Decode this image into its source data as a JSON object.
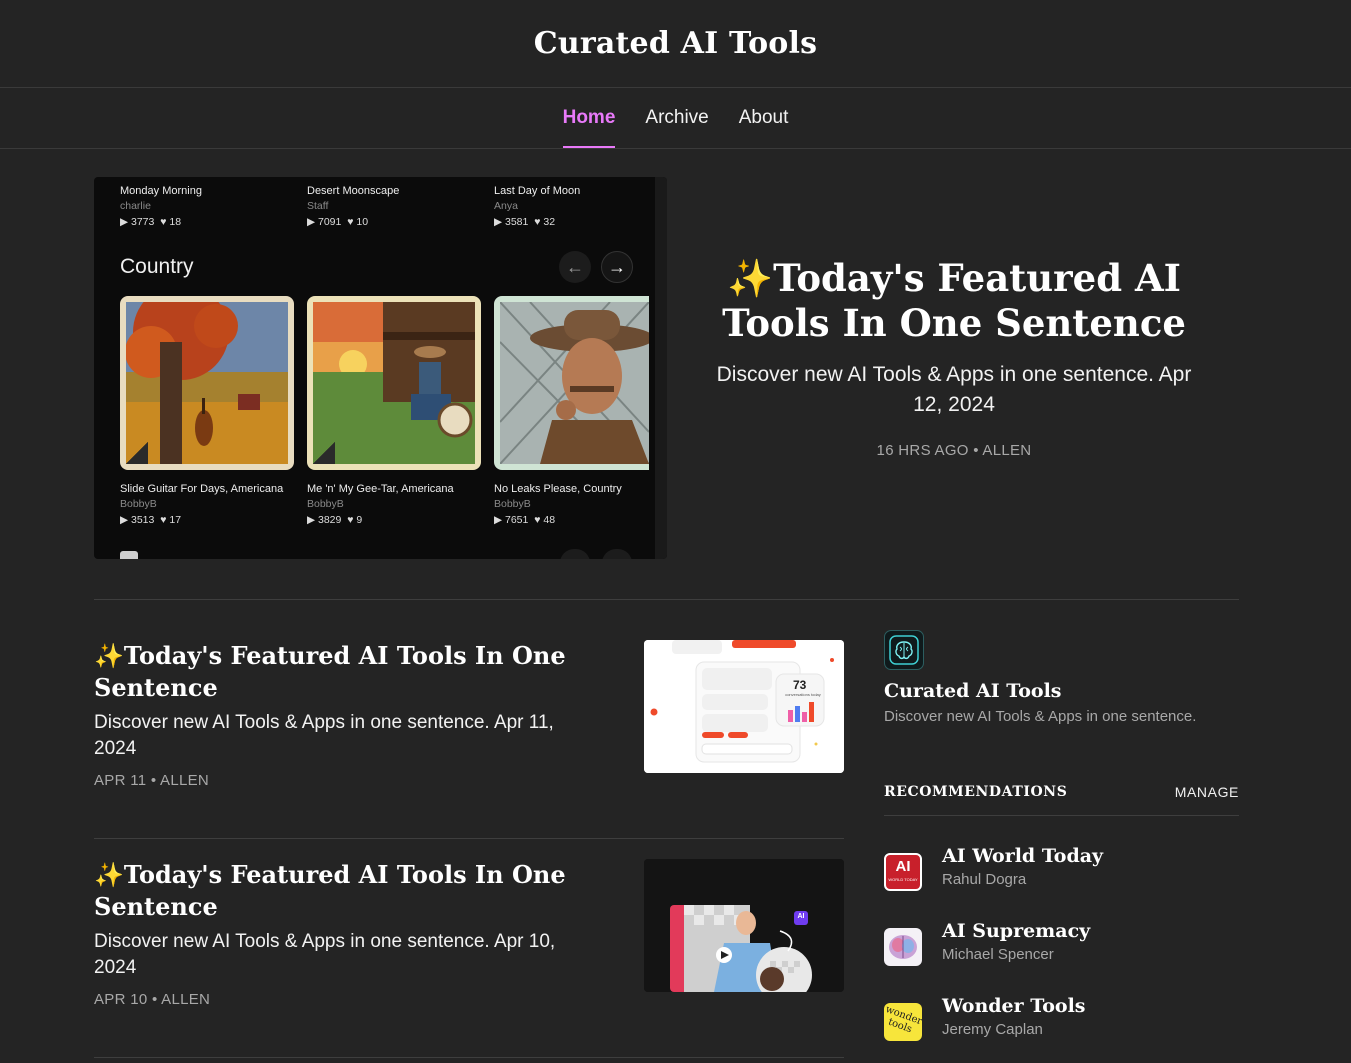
{
  "site": {
    "title": "Curated AI Tools"
  },
  "nav": {
    "tabs": [
      {
        "label": "Home",
        "active": true
      },
      {
        "label": "Archive"
      },
      {
        "label": "About"
      }
    ]
  },
  "hero": {
    "title": "✨Today's Featured AI Tools In One Sentence",
    "subtitle": "Discover new AI Tools & Apps in one sentence. Apr 12, 2024",
    "meta": "16 HRS AGO • ALLEN",
    "image": {
      "top_tracks": [
        {
          "name": "Monday Morning",
          "artist": "charlie",
          "plays": "3773",
          "likes": "18"
        },
        {
          "name": "Desert Moonscape",
          "artist": "Staff",
          "plays": "7091",
          "likes": "10"
        },
        {
          "name": "Last Day of Moon",
          "artist": "Anya",
          "plays": "3581",
          "likes": "32"
        }
      ],
      "genre": "Country",
      "bottom_tracks": [
        {
          "name": "Slide Guitar For Days, Americana",
          "artist": "BobbyB",
          "plays": "3513",
          "likes": "17"
        },
        {
          "name": "Me 'n' My Gee-Tar, Americana",
          "artist": "BobbyB",
          "plays": "3829",
          "likes": "9"
        },
        {
          "name": "No Leaks Please, Country",
          "artist": "BobbyB",
          "plays": "7651",
          "likes": "48"
        }
      ]
    }
  },
  "posts": [
    {
      "title": "✨Today's Featured AI Tools In One Sentence",
      "subtitle": "Discover new AI Tools & Apps in one sentence. Apr 11, 2024",
      "meta": "APR 11 • ALLEN",
      "thumb_stat": "73",
      "thumb_stat_label": "conversations today"
    },
    {
      "title": "✨Today's Featured AI Tools In One Sentence",
      "subtitle": "Discover new AI Tools & Apps in one sentence. Apr 10, 2024",
      "meta": "APR 10 • ALLEN",
      "thumb_badge": "AI"
    }
  ],
  "sidebar": {
    "pub_name": "Curated AI Tools",
    "pub_desc": "Discover new AI Tools & Apps in one sentence.",
    "rec_title": "RECOMMENDATIONS",
    "rec_manage": "MANAGE",
    "recommendations": [
      {
        "name": "AI World Today",
        "author": "Rahul Dogra",
        "logo_text": "AI",
        "logo_sub": "WORLD TODAY"
      },
      {
        "name": "AI Supremacy",
        "author": "Michael Spencer"
      },
      {
        "name": "Wonder Tools",
        "author": "Jeremy Caplan",
        "logo_text": "wonder tools"
      }
    ]
  },
  "colors": {
    "background": "#242424",
    "accent": "#e879f9",
    "muted": "#a8a8a8",
    "divider": "#3e3e3e"
  }
}
